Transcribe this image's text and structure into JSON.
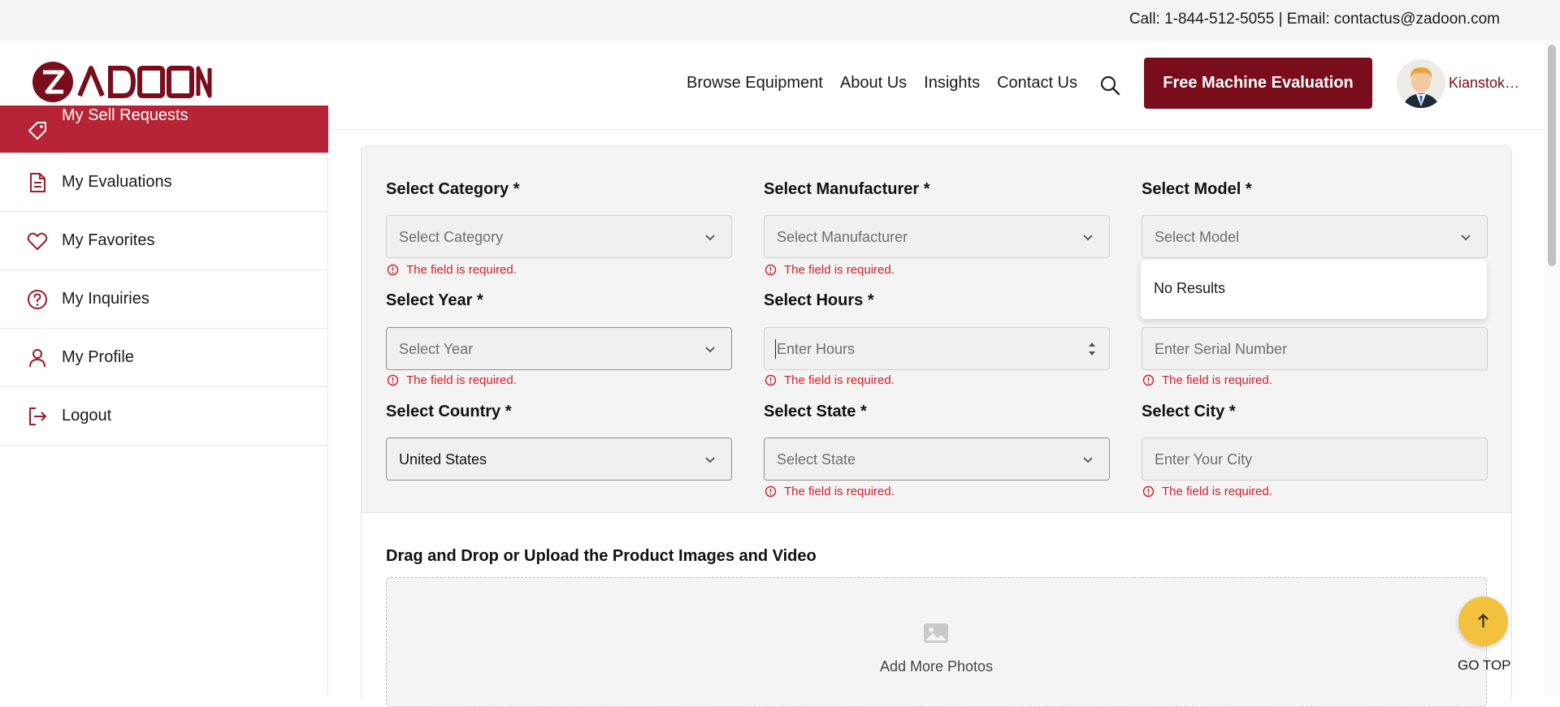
{
  "topbar": {
    "contact": "Call: 1-844-512-5055 | Email: contactus@zadoon.com"
  },
  "header": {
    "logo_text": "ZADOON",
    "nav": [
      "Browse Equipment",
      "About Us",
      "Insights",
      "Contact Us"
    ],
    "cta_label": "Free Machine Evaluation",
    "username": "Kianstok…",
    "brand_color": "#7a0d1c"
  },
  "sidebar": {
    "items": [
      {
        "label": "My Sell Requests",
        "icon": "tag-icon"
      },
      {
        "label": "My Evaluations",
        "icon": "document-icon"
      },
      {
        "label": "My Favorites",
        "icon": "heart-icon"
      },
      {
        "label": "My Inquiries",
        "icon": "question-circle-icon"
      },
      {
        "label": "My Profile",
        "icon": "user-icon"
      },
      {
        "label": "Logout",
        "icon": "logout-icon"
      }
    ],
    "active_color": "#b72438"
  },
  "form": {
    "category": {
      "label": "Select Category *",
      "placeholder": "Select Category",
      "error": "The field is required."
    },
    "manufacturer": {
      "label": "Select Manufacturer *",
      "placeholder": "Select Manufacturer",
      "error": "The field is required."
    },
    "model": {
      "label": "Select Model *",
      "placeholder": "Select Model",
      "dropdown_text": "No Results"
    },
    "year": {
      "label": "Select Year *",
      "placeholder": "Select Year",
      "error": "The field is required."
    },
    "hours": {
      "label": "Select Hours *",
      "placeholder": "Enter Hours",
      "error": "The field is required."
    },
    "serial": {
      "placeholder": "Enter Serial Number",
      "error": "The field is required."
    },
    "country": {
      "label": "Select Country *",
      "value": "United States"
    },
    "state": {
      "label": "Select State *",
      "placeholder": "Select State",
      "error": "The field is required."
    },
    "city": {
      "label": "Select City *",
      "placeholder": "Enter Your City",
      "error": "The field is required."
    },
    "error_color": "#d21f2a"
  },
  "upload": {
    "title": "Drag and Drop or Upload the Product Images and Video",
    "add_label": "Add More Photos"
  },
  "gotop": {
    "label": "GO TOP",
    "color": "#f2c23e"
  }
}
